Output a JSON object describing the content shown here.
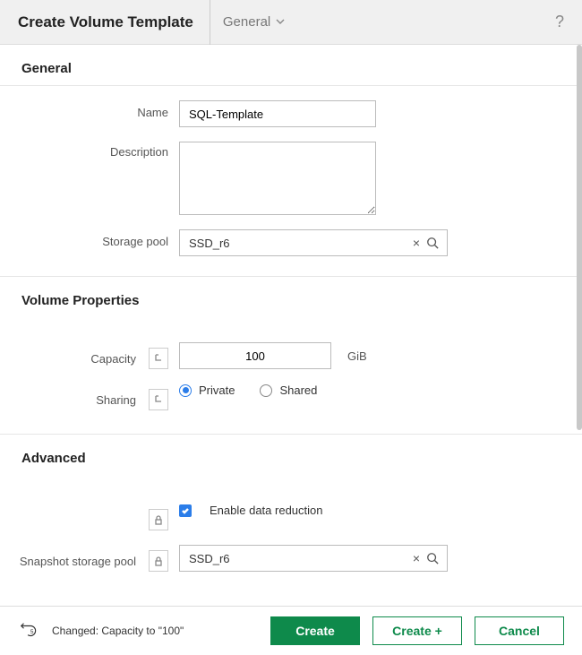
{
  "header": {
    "title": "Create Volume Template",
    "dropdown": "General",
    "help_tooltip": "?"
  },
  "sections": {
    "general": {
      "title": "General",
      "name_label": "Name",
      "name_value": "SQL-Template",
      "description_label": "Description",
      "description_value": "",
      "pool_label": "Storage pool",
      "pool_value": "SSD_r6"
    },
    "props": {
      "title": "Volume Properties",
      "capacity_label": "Capacity",
      "capacity_value": "100",
      "capacity_unit": "GiB",
      "sharing_label": "Sharing",
      "sharing_private": "Private",
      "sharing_shared": "Shared",
      "sharing_selected": "private"
    },
    "advanced": {
      "title": "Advanced",
      "dr_label": "Enable data reduction",
      "dr_checked": true,
      "snap_label": "Snapshot storage pool",
      "snap_value": "SSD_r6"
    }
  },
  "footer": {
    "status": "Changed: Capacity to \"100\"",
    "create": "Create",
    "create_plus": "Create +",
    "cancel": "Cancel"
  }
}
